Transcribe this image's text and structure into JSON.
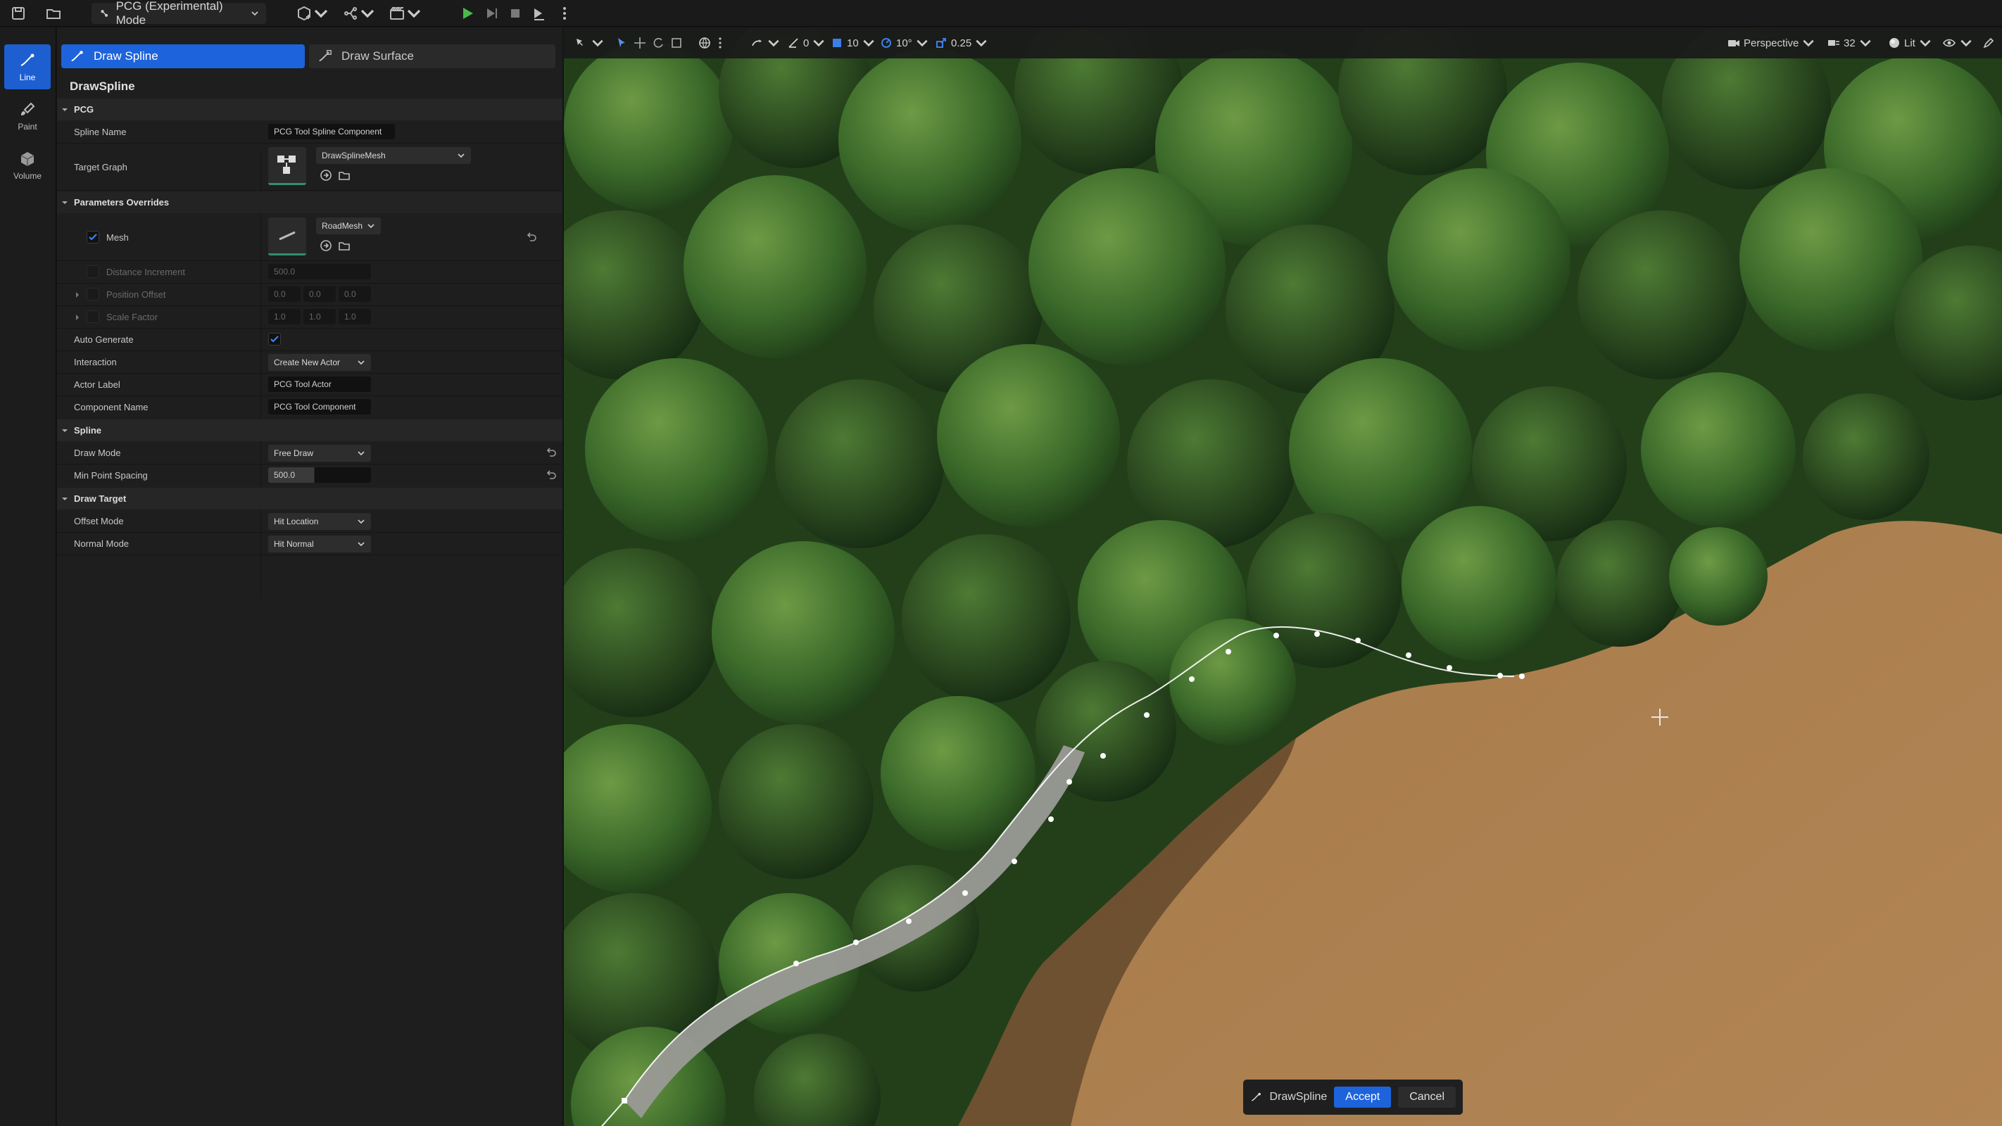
{
  "toolbar": {
    "mode_label": "PCG (Experimental) Mode",
    "snap_rotate": "0",
    "snap_grid": "10",
    "snap_angle": "10°",
    "snap_scale": "0.25",
    "view_mode": "Perspective",
    "fov": "32",
    "lighting": "Lit"
  },
  "mode_rail": {
    "items": [
      {
        "label": "Line"
      },
      {
        "label": "Paint"
      },
      {
        "label": "Volume"
      }
    ]
  },
  "panel": {
    "tabs": [
      {
        "label": "Draw Spline"
      },
      {
        "label": "Draw Surface"
      }
    ],
    "title": "DrawSpline",
    "sections": {
      "pcg": "PCG",
      "param_overrides": "Parameters Overrides",
      "spline": "Spline",
      "draw_target": "Draw Target"
    },
    "props": {
      "spline_name": {
        "label": "Spline Name",
        "value": "PCG Tool Spline Component"
      },
      "target_graph": {
        "label": "Target Graph",
        "value": "DrawSplineMesh"
      },
      "mesh": {
        "label": "Mesh",
        "value": "RoadMesh"
      },
      "distance_increment": {
        "label": "Distance Increment",
        "value": "500.0"
      },
      "position_offset": {
        "label": "Position Offset",
        "x": "0.0",
        "y": "0.0",
        "z": "0.0"
      },
      "scale_factor": {
        "label": "Scale Factor",
        "x": "1.0",
        "y": "1.0",
        "z": "1.0"
      },
      "auto_generate": {
        "label": "Auto Generate"
      },
      "interaction": {
        "label": "Interaction",
        "value": "Create New Actor"
      },
      "actor_label": {
        "label": "Actor Label",
        "value": "PCG Tool Actor"
      },
      "component_name": {
        "label": "Component Name",
        "value": "PCG Tool Component"
      },
      "draw_mode": {
        "label": "Draw Mode",
        "value": "Free Draw"
      },
      "min_point_spacing": {
        "label": "Min Point Spacing",
        "value": "500.0"
      },
      "offset_mode": {
        "label": "Offset Mode",
        "value": "Hit Location"
      },
      "normal_mode": {
        "label": "Normal Mode",
        "value": "Hit Normal"
      }
    }
  },
  "confirm_bar": {
    "tool_name": "DrawSpline",
    "accept": "Accept",
    "cancel": "Cancel"
  },
  "colors": {
    "accent": "#1d63db",
    "panel_bg": "#1e1e1e",
    "ground": "#a5784a",
    "forest": "#2f5a22"
  }
}
